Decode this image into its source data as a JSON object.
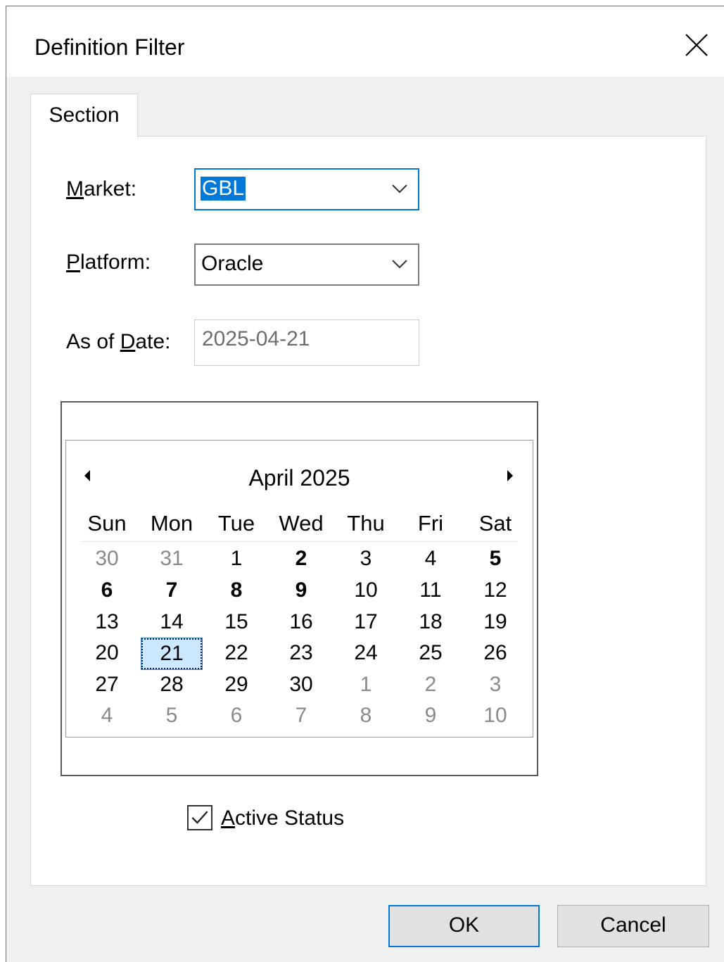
{
  "window": {
    "title": "Definition Filter",
    "close_icon": "close-icon"
  },
  "tabs": [
    {
      "label": "Section",
      "active": true
    }
  ],
  "fields": {
    "market": {
      "label_accel": "M",
      "label_rest": "arket:",
      "value": "GBL"
    },
    "platform": {
      "label_accel": "P",
      "label_rest": "latform:",
      "value": "Oracle"
    },
    "as_of_date": {
      "label_pre": "As of ",
      "label_accel": "D",
      "label_rest": "ate:",
      "value": "2025-04-21"
    }
  },
  "calendar": {
    "month_label": "April 2025",
    "weekdays": [
      "Sun",
      "Mon",
      "Tue",
      "Wed",
      "Thu",
      "Fri",
      "Sat"
    ],
    "weeks": [
      [
        {
          "d": "30",
          "trail": true
        },
        {
          "d": "31",
          "trail": true
        },
        {
          "d": "1"
        },
        {
          "d": "2",
          "bold": true
        },
        {
          "d": "3"
        },
        {
          "d": "4"
        },
        {
          "d": "5",
          "bold": true
        }
      ],
      [
        {
          "d": "6",
          "bold": true
        },
        {
          "d": "7",
          "bold": true
        },
        {
          "d": "8",
          "bold": true
        },
        {
          "d": "9",
          "bold": true
        },
        {
          "d": "10"
        },
        {
          "d": "11"
        },
        {
          "d": "12"
        }
      ],
      [
        {
          "d": "13"
        },
        {
          "d": "14"
        },
        {
          "d": "15"
        },
        {
          "d": "16"
        },
        {
          "d": "17"
        },
        {
          "d": "18"
        },
        {
          "d": "19"
        }
      ],
      [
        {
          "d": "20"
        },
        {
          "d": "21",
          "selected": true
        },
        {
          "d": "22"
        },
        {
          "d": "23"
        },
        {
          "d": "24"
        },
        {
          "d": "25"
        },
        {
          "d": "26"
        }
      ],
      [
        {
          "d": "27"
        },
        {
          "d": "28"
        },
        {
          "d": "29"
        },
        {
          "d": "30"
        },
        {
          "d": "1",
          "trail": true
        },
        {
          "d": "2",
          "trail": true
        },
        {
          "d": "3",
          "trail": true
        }
      ],
      [
        {
          "d": "4",
          "trail": true
        },
        {
          "d": "5",
          "trail": true
        },
        {
          "d": "6",
          "trail": true
        },
        {
          "d": "7",
          "trail": true
        },
        {
          "d": "8",
          "trail": true
        },
        {
          "d": "9",
          "trail": true
        },
        {
          "d": "10",
          "trail": true
        }
      ]
    ]
  },
  "active_status": {
    "accel": "A",
    "label_rest": "ctive Status",
    "checked": true
  },
  "buttons": {
    "ok": "OK",
    "cancel": "Cancel"
  },
  "colors": {
    "accent": "#0078d7",
    "selection": "#cce8ff"
  }
}
